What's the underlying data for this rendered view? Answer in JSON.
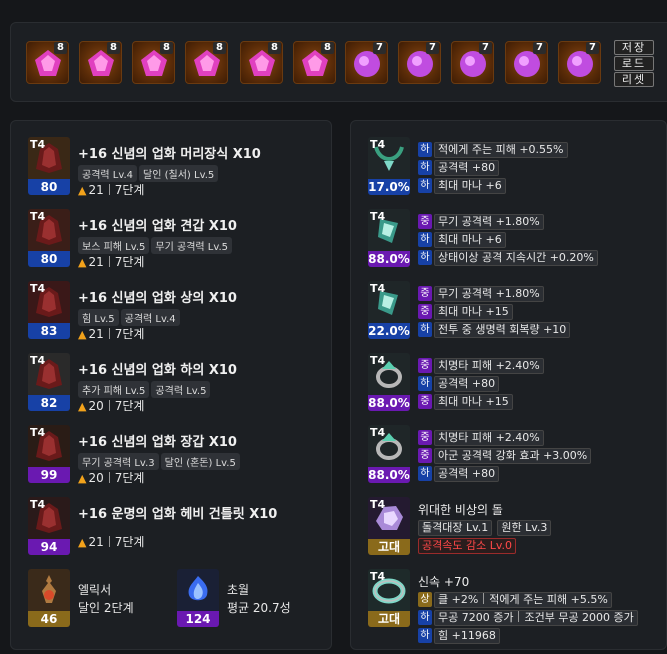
{
  "gems": [
    {
      "level": "8",
      "type": "annihilation"
    },
    {
      "level": "8",
      "type": "annihilation"
    },
    {
      "level": "8",
      "type": "annihilation"
    },
    {
      "level": "8",
      "type": "annihilation"
    },
    {
      "level": "8",
      "type": "annihilation"
    },
    {
      "level": "8",
      "type": "annihilation"
    },
    {
      "level": "7",
      "type": "crimson"
    },
    {
      "level": "7",
      "type": "crimson"
    },
    {
      "level": "7",
      "type": "crimson"
    },
    {
      "level": "7",
      "type": "crimson"
    },
    {
      "level": "7",
      "type": "crimson"
    }
  ],
  "side_buttons": {
    "save": "저장",
    "load": "로드",
    "reset": "리셋"
  },
  "equipment": [
    {
      "tier": "T4",
      "quality": "80",
      "quality_color": "blue",
      "name": "+16 신념의 업화 머리장식 ",
      "set": "X10",
      "tags": [
        "공격력 Lv.4",
        "달인 (칠서) Lv.5"
      ],
      "flame": "21",
      "step": "7단계",
      "icon": "helmet-icon"
    },
    {
      "tier": "T4",
      "quality": "80",
      "quality_color": "blue",
      "name": "+16 신념의 업화 견갑 ",
      "set": "X10",
      "tags": [
        "보스 피해 Lv.5",
        "무기 공격력 Lv.5"
      ],
      "flame": "21",
      "step": "7단계",
      "icon": "shoulder-icon"
    },
    {
      "tier": "T4",
      "quality": "83",
      "quality_color": "blue",
      "name": "+16 신념의 업화 상의 ",
      "set": "X10",
      "tags": [
        "힘 Lv.5",
        "공격력 Lv.4"
      ],
      "flame": "21",
      "step": "7단계",
      "icon": "chest-icon"
    },
    {
      "tier": "T4",
      "quality": "82",
      "quality_color": "blue",
      "name": "+16 신념의 업화 하의 ",
      "set": "X10",
      "tags": [
        "추가 피해 Lv.5",
        "공격력 Lv.5"
      ],
      "flame": "20",
      "step": "7단계",
      "icon": "pants-icon"
    },
    {
      "tier": "T4",
      "quality": "99",
      "quality_color": "purple",
      "name": "+16 신념의 업화 장갑 ",
      "set": "X10",
      "tags": [
        "무기 공격력 Lv.3",
        "달인 (혼돈) Lv.5"
      ],
      "flame": "20",
      "step": "7단계",
      "icon": "gloves-icon"
    },
    {
      "tier": "T4",
      "quality": "94",
      "quality_color": "purple",
      "name": "+16 운명의 업화 헤비 건틀릿 ",
      "set": "X10",
      "tags": [],
      "flame": "21",
      "step": "7단계",
      "icon": "weapon-icon"
    }
  ],
  "elixir": {
    "quality": "46",
    "title": "엘릭서",
    "value": "달인 2단계"
  },
  "transcend": {
    "quality": "124",
    "title": "초월",
    "value": "평균 20.7성"
  },
  "accessories": [
    {
      "tier": "T4",
      "quality": "17.0%",
      "quality_color": "blue",
      "icon": "necklace-icon",
      "lines": [
        {
          "grade": "하",
          "g": "low",
          "text": "적에게 주는 피해 +0.55%"
        },
        {
          "grade": "하",
          "g": "low",
          "text": "공격력 +80"
        },
        {
          "grade": "하",
          "g": "low",
          "text": "최대 마나 +6"
        }
      ]
    },
    {
      "tier": "T4",
      "quality": "88.0%",
      "quality_color": "purple",
      "icon": "earring-icon",
      "lines": [
        {
          "grade": "중",
          "g": "mid",
          "text": "무기 공격력 +1.80%"
        },
        {
          "grade": "하",
          "g": "low",
          "text": "최대 마나 +6"
        },
        {
          "grade": "하",
          "g": "low",
          "text": "상태이상 공격 지속시간 +0.20%"
        }
      ]
    },
    {
      "tier": "T4",
      "quality": "22.0%",
      "quality_color": "blue",
      "icon": "earring-icon",
      "lines": [
        {
          "grade": "중",
          "g": "mid",
          "text": "무기 공격력 +1.80%"
        },
        {
          "grade": "중",
          "g": "mid",
          "text": "최대 마나 +15"
        },
        {
          "grade": "하",
          "g": "low",
          "text": "전투 중 생명력 회복량 +10"
        }
      ]
    },
    {
      "tier": "T4",
      "quality": "88.0%",
      "quality_color": "purple",
      "icon": "ring-icon",
      "lines": [
        {
          "grade": "중",
          "g": "mid",
          "text": "치명타 피해 +2.40%"
        },
        {
          "grade": "하",
          "g": "low",
          "text": "공격력 +80"
        },
        {
          "grade": "중",
          "g": "mid",
          "text": "최대 마나 +15"
        }
      ]
    },
    {
      "tier": "T4",
      "quality": "88.0%",
      "quality_color": "purple",
      "icon": "ring-icon",
      "lines": [
        {
          "grade": "중",
          "g": "mid",
          "text": "치명타 피해 +2.40%"
        },
        {
          "grade": "중",
          "g": "mid",
          "text": "아군 공격력 강화 효과 +3.00%"
        },
        {
          "grade": "하",
          "g": "low",
          "text": "공격력 +80"
        }
      ]
    }
  ],
  "stone": {
    "tier": "T4",
    "rarity": "고대",
    "title": "위대한 비상의 돌",
    "eng1": "돌격대장 Lv.1",
    "eng2": "원한 Lv.3",
    "neg": "공격속도 감소 Lv.0"
  },
  "bracelet": {
    "tier": "T4",
    "rarity": "고대",
    "title": "신속 +70",
    "l1_grade": "상",
    "l1a": "클 +2%",
    "l1b": "적에게 주는 피해 +5.5%",
    "l2_grade": "하",
    "l2a": "무공 7200 증가",
    "l2b": "조건부 무공 2000 증가",
    "l3_grade": "하",
    "l3": "힘 +11968"
  },
  "colors": {
    "bg": "#15171a",
    "panel": "#1c1f23",
    "low": "#1741a6",
    "mid": "#6a19b1",
    "high": "#8a6a1b"
  }
}
